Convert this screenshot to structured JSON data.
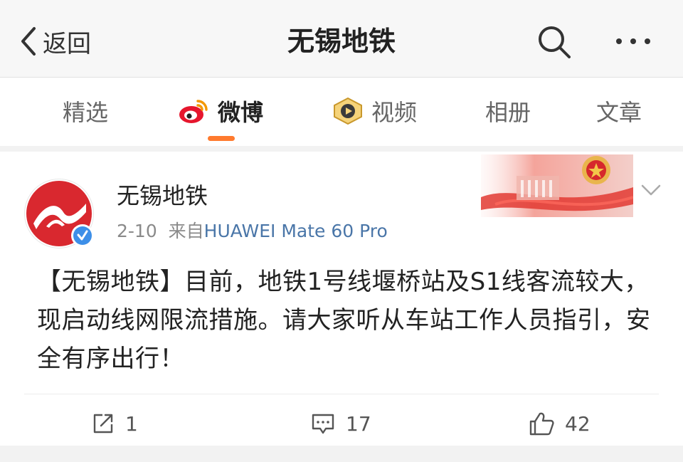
{
  "nav": {
    "back_label": "返回",
    "title": "无锡地铁",
    "search_icon": "search-icon",
    "more_icon": "more-icon"
  },
  "tabs": [
    {
      "label": "精选",
      "active": false
    },
    {
      "label": "微博",
      "active": true,
      "icon": "weibo-logo-icon"
    },
    {
      "label": "视频",
      "active": false,
      "icon": "video-badge-icon"
    },
    {
      "label": "相册",
      "active": false
    },
    {
      "label": "文章",
      "active": false
    }
  ],
  "post": {
    "author": "无锡地铁",
    "date": "2-10",
    "source_prefix": "来自",
    "source": "HUAWEI Mate 60 Pro",
    "text": "【无锡地铁】目前，地铁1号线堰桥站及S1线客流较大，现启动线网限流措施。请大家听从车站工作人员指引，安全有序出行！",
    "actions": {
      "repost": "1",
      "comment": "17",
      "like": "42"
    }
  },
  "colors": {
    "accent": "#ff7a2e",
    "link": "#4a76a8",
    "brand_red": "#d9282f",
    "verified_blue": "#3d8fe8"
  }
}
